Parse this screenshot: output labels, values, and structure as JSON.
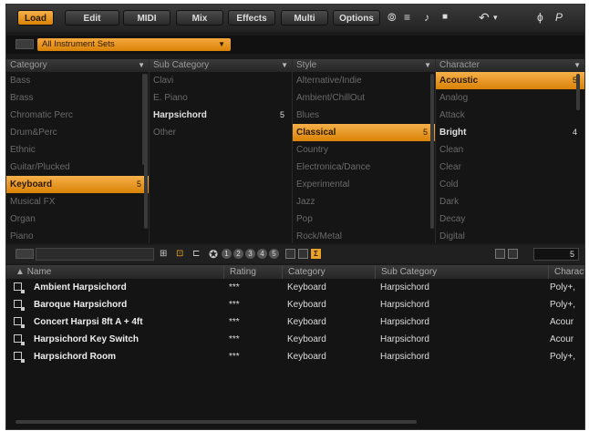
{
  "toolbar": {
    "tabs": [
      {
        "label": "Load",
        "active": true
      },
      {
        "label": "Edit"
      },
      {
        "label": "MIDI"
      },
      {
        "label": "Mix"
      },
      {
        "label": "Effects"
      },
      {
        "label": "Multi"
      },
      {
        "label": "Options"
      }
    ],
    "icons": [
      "plug-in-icon",
      "cable-icon",
      "note-icon",
      "lock-icon",
      "undo-icon",
      "undo-menu-icon",
      "tuning-icon",
      "panic-icon"
    ],
    "icon_glyphs": [
      "⦾",
      "≡",
      "♪",
      "■",
      "↶",
      "▾",
      "ϕ",
      "P"
    ]
  },
  "instrument_set": {
    "selected": "All Instrument Sets",
    "arrow": "▼"
  },
  "columns": [
    {
      "header": "Category",
      "items": [
        {
          "label": "Bass"
        },
        {
          "label": "Brass"
        },
        {
          "label": "Chromatic Perc"
        },
        {
          "label": "Drum&Perc"
        },
        {
          "label": "Ethnic"
        },
        {
          "label": "Guitar/Plucked"
        },
        {
          "label": "Keyboard",
          "count": "5",
          "state": "highlight"
        },
        {
          "label": "Musical FX"
        },
        {
          "label": "Organ"
        },
        {
          "label": "Piano"
        }
      ]
    },
    {
      "header": "Sub Category",
      "items": [
        {
          "label": "Clavi"
        },
        {
          "label": "E. Piano"
        },
        {
          "label": "Harpsichord",
          "count": "5",
          "state": "bold"
        },
        {
          "label": "Other"
        }
      ]
    },
    {
      "header": "Style",
      "items": [
        {
          "label": "Alternative/Indie"
        },
        {
          "label": "Ambient/ChillOut"
        },
        {
          "label": "Blues"
        },
        {
          "label": "Classical",
          "count": "5",
          "state": "highlight"
        },
        {
          "label": "Country"
        },
        {
          "label": "Electronica/Dance"
        },
        {
          "label": "Experimental"
        },
        {
          "label": "Jazz"
        },
        {
          "label": "Pop"
        },
        {
          "label": "Rock/Metal"
        }
      ]
    },
    {
      "header": "Character",
      "items": [
        {
          "label": "Acoustic",
          "count": "5",
          "state": "highlight"
        },
        {
          "label": "Analog"
        },
        {
          "label": "Attack"
        },
        {
          "label": "Bright",
          "count": "4",
          "state": "bold"
        },
        {
          "label": "Clean"
        },
        {
          "label": "Clear"
        },
        {
          "label": "Cold"
        },
        {
          "label": "Dark"
        },
        {
          "label": "Decay"
        },
        {
          "label": "Digital"
        }
      ]
    }
  ],
  "filterbar": {
    "ratings": [
      "1",
      "2",
      "3",
      "4",
      "5"
    ],
    "sigma": "Σ",
    "result_count": "5"
  },
  "table": {
    "columns": [
      "Name",
      "Rating",
      "Category",
      "Sub Category",
      "Character"
    ],
    "rows": [
      {
        "name": "Ambient Harpsichord",
        "rating": "***",
        "category": "Keyboard",
        "subcategory": "Harpsichord",
        "character": "Poly+,"
      },
      {
        "name": "Baroque Harpsichord",
        "rating": "***",
        "category": "Keyboard",
        "subcategory": "Harpsichord",
        "character": "Poly+,"
      },
      {
        "name": "Concert Harpsi 8ft A + 4ft",
        "rating": "***",
        "category": "Keyboard",
        "subcategory": "Harpsichord",
        "character": "Acour"
      },
      {
        "name": "Harpsichord Key Switch",
        "rating": "***",
        "category": "Keyboard",
        "subcategory": "Harpsichord",
        "character": "Acour"
      },
      {
        "name": "Harpsichord Room",
        "rating": "***",
        "category": "Keyboard",
        "subcategory": "Harpsichord",
        "character": "Poly+,"
      }
    ]
  },
  "colors": {
    "accent": "#e9a227",
    "background": "#1a1a1a"
  }
}
